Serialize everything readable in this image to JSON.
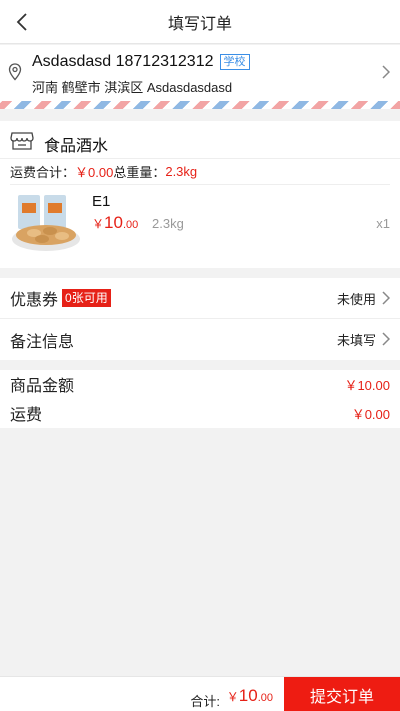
{
  "nav": {
    "title": "填写订单"
  },
  "address": {
    "name_phone": "Asdasdasd 18712312312",
    "tag": "学校",
    "detail": "河南 鹤壁市 淇滨区  Asdasdasdasd"
  },
  "store": {
    "name": "食品酒水",
    "shipping_label": "运费合计：",
    "shipping_value": "￥0.00",
    "weight_label": " 总重量：",
    "weight_value": "2.3kg",
    "item": {
      "name": "E1",
      "currency": "￥",
      "price_int": "10",
      "price_dec": ".00",
      "weight": "2.3kg",
      "qty": "x1"
    }
  },
  "options": {
    "coupon_label": "优惠券",
    "coupon_badge": "0张可用",
    "coupon_value": "未使用",
    "note_label": "备注信息",
    "note_value": "未填写"
  },
  "totals": {
    "goods_label": "商品金额",
    "goods_value": "￥10.00",
    "freight_label": "运费",
    "freight_value": "￥0.00"
  },
  "footer": {
    "total_label": "合计:",
    "currency": "￥",
    "total_int": "10",
    "total_dec": ".00",
    "submit_label": "提交订单"
  },
  "colors": {
    "accent": "#e62117",
    "tag": "#3a8ee6"
  }
}
